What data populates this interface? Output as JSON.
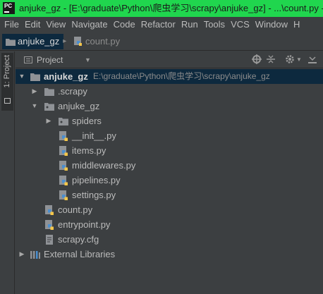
{
  "window": {
    "title": "anjuke_gz - [E:\\graduate\\Python\\爬虫学习\\scrapy\\anjuke_gz] - ...\\count.py - PyC",
    "app_icon_text": "PC"
  },
  "menu": [
    {
      "label": "File"
    },
    {
      "label": "Edit"
    },
    {
      "label": "View"
    },
    {
      "label": "Navigate"
    },
    {
      "label": "Code"
    },
    {
      "label": "Refactor"
    },
    {
      "label": "Run"
    },
    {
      "label": "Tools"
    },
    {
      "label": "VCS"
    },
    {
      "label": "Window"
    },
    {
      "label": "H"
    }
  ],
  "navbar": {
    "project": "anjuke_gz",
    "file": "count.py"
  },
  "sidebar": {
    "tab_label": "1: Project"
  },
  "panel": {
    "view_label": "Project",
    "icons": [
      "locate-icon",
      "collapse-all-icon",
      "settings-gear-icon",
      "hide-panel-icon"
    ]
  },
  "tree": [
    {
      "label": "anjuke_gz",
      "path": "E:\\graduate\\Python\\爬虫学习\\scrapy\\anjuke_gz",
      "type": "project-folder",
      "expanded": true
    },
    {
      "label": ".scrapy",
      "type": "folder",
      "expanded": false
    },
    {
      "label": "anjuke_gz",
      "type": "package",
      "expanded": true
    },
    {
      "label": "spiders",
      "type": "package",
      "expanded": false
    },
    {
      "label": "__init__.py",
      "type": "python-file"
    },
    {
      "label": "items.py",
      "type": "python-file"
    },
    {
      "label": "middlewares.py",
      "type": "python-file"
    },
    {
      "label": "pipelines.py",
      "type": "python-file"
    },
    {
      "label": "settings.py",
      "type": "python-file"
    },
    {
      "label": "count.py",
      "type": "python-file"
    },
    {
      "label": "entrypoint.py",
      "type": "python-file"
    },
    {
      "label": "scrapy.cfg",
      "type": "config-file"
    },
    {
      "label": "External Libraries",
      "type": "libraries",
      "expanded": false
    }
  ],
  "colors": {
    "title_bar": "#20d64e",
    "background": "#3c3f41",
    "selection": "#0d293e",
    "text": "#bbbbbb",
    "folder": "#8f9296",
    "python_blue": "#4a8fd0",
    "python_yellow": "#f5c74a"
  }
}
